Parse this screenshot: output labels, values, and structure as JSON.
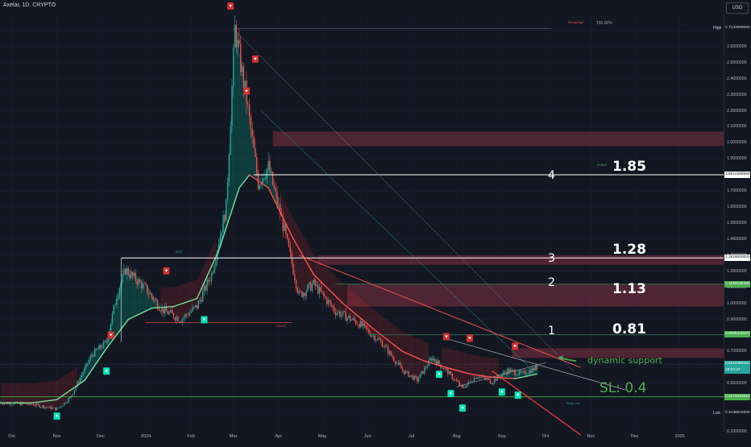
{
  "header": {
    "symbol": "Axelar",
    "interval": "1D",
    "exchange": "CRYPTO",
    "currency": "USD"
  },
  "colors": {
    "background": "#131722",
    "bull": "#26a69a",
    "bear": "#ef5350",
    "zone": "#b2394f",
    "band_teal": "#00e6b4",
    "band_red": "#d32f2f",
    "annotation_green": "#4caf50",
    "white": "#ffffff"
  },
  "chart_data": {
    "type": "candlestick",
    "title": "Axelar · 1D · CRYPTO",
    "y_axis": {
      "range": [
        0.2,
        2.8
      ],
      "ticks": [
        0.2,
        0.3,
        0.4,
        0.5,
        0.6,
        0.7,
        0.8,
        0.9,
        1.0,
        1.1,
        1.2,
        1.3,
        1.4,
        1.5,
        1.6,
        1.7,
        1.8,
        1.9,
        2.0,
        2.1,
        2.2,
        2.3,
        2.4,
        2.5,
        2.6,
        2.7
      ],
      "tick_labels": [
        "0.2000000",
        "0.3000000",
        "0.4000000",
        "0.5000000",
        "0.6000000",
        "0.7000000",
        "0.8000000",
        "0.9000000",
        "1.0000000",
        "1.1000000",
        "1.2000000",
        "1.3000000",
        "1.4000000",
        "1.5000000",
        "1.6000000",
        "1.7000000",
        "1.8000000",
        "1.9000000",
        "2.0000000",
        "2.1000000",
        "2.2000000",
        "2.3000000",
        "2.4000000",
        "2.5000000",
        "2.6000000",
        "2.7000000"
      ]
    },
    "x_axis": {
      "range": [
        "2023-09-23",
        "2025-01-31"
      ],
      "ticks": [
        {
          "date": "2023-10-01",
          "label": "Oct"
        },
        {
          "date": "2023-11-01",
          "label": "Nov"
        },
        {
          "date": "2023-12-01",
          "label": "Dec"
        },
        {
          "date": "2024-01-01",
          "label": "2024"
        },
        {
          "date": "2024-02-01",
          "label": "Feb"
        },
        {
          "date": "2024-03-01",
          "label": "Mar"
        },
        {
          "date": "2024-04-01",
          "label": "Apr"
        },
        {
          "date": "2024-05-01",
          "label": "May"
        },
        {
          "date": "2024-06-01",
          "label": "Jun"
        },
        {
          "date": "2024-07-01",
          "label": "Jul"
        },
        {
          "date": "2024-08-01",
          "label": "Aug"
        },
        {
          "date": "2024-09-01",
          "label": "Sep"
        },
        {
          "date": "2024-10-01",
          "label": "Oct"
        },
        {
          "date": "2024-11-01",
          "label": "Nov"
        },
        {
          "date": "2024-12-01",
          "label": "Dec"
        },
        {
          "date": "2025-01-01",
          "label": "2025"
        }
      ]
    },
    "price_path": [
      [
        "2023-09-23",
        0.38
      ],
      [
        "2023-10-15",
        0.37
      ],
      [
        "2023-11-01",
        0.34
      ],
      [
        "2023-11-10",
        0.41
      ],
      [
        "2023-11-25",
        0.68
      ],
      [
        "2023-12-05",
        0.76
      ],
      [
        "2023-12-12",
        1.05
      ],
      [
        "2023-12-18",
        1.21
      ],
      [
        "2024-01-01",
        1.09
      ],
      [
        "2024-01-12",
        0.96
      ],
      [
        "2024-01-25",
        0.9
      ],
      [
        "2024-02-05",
        0.98
      ],
      [
        "2024-02-15",
        1.18
      ],
      [
        "2024-02-25",
        1.6
      ],
      [
        "2024-03-02",
        2.71
      ],
      [
        "2024-03-10",
        2.27
      ],
      [
        "2024-03-18",
        1.75
      ],
      [
        "2024-03-25",
        1.85
      ],
      [
        "2024-04-05",
        1.45
      ],
      [
        "2024-04-15",
        1.05
      ],
      [
        "2024-04-25",
        1.12
      ],
      [
        "2024-05-10",
        0.95
      ],
      [
        "2024-05-25",
        0.88
      ],
      [
        "2024-06-10",
        0.76
      ],
      [
        "2024-06-25",
        0.58
      ],
      [
        "2024-07-05",
        0.52
      ],
      [
        "2024-07-15",
        0.66
      ],
      [
        "2024-07-25",
        0.58
      ],
      [
        "2024-08-05",
        0.47
      ],
      [
        "2024-08-15",
        0.55
      ],
      [
        "2024-08-25",
        0.51
      ],
      [
        "2024-09-05",
        0.58
      ],
      [
        "2024-09-15",
        0.56
      ],
      [
        "2024-09-25",
        0.6
      ]
    ],
    "ma_line": {
      "name": "",
      "points": [
        [
          "2023-09-23",
          0.38
        ],
        [
          "2023-10-15",
          0.38
        ],
        [
          "2023-11-01",
          0.4
        ],
        [
          "2023-11-20",
          0.52
        ],
        [
          "2023-12-05",
          0.72
        ],
        [
          "2023-12-20",
          0.9
        ],
        [
          "2024-01-05",
          0.97
        ],
        [
          "2024-01-20",
          0.98
        ],
        [
          "2024-02-05",
          1.03
        ],
        [
          "2024-02-20",
          1.33
        ],
        [
          "2024-03-05",
          1.72
        ],
        [
          "2024-03-12",
          1.8
        ],
        [
          "2024-03-25",
          1.72
        ],
        [
          "2024-04-10",
          1.42
        ],
        [
          "2024-04-25",
          1.18
        ],
        [
          "2024-05-15",
          1.0
        ],
        [
          "2024-06-05",
          0.84
        ],
        [
          "2024-06-25",
          0.7
        ],
        [
          "2024-07-10",
          0.64
        ],
        [
          "2024-07-25",
          0.6
        ],
        [
          "2024-08-10",
          0.56
        ],
        [
          "2024-08-25",
          0.54
        ],
        [
          "2024-09-10",
          0.53
        ],
        [
          "2024-09-25",
          0.56
        ]
      ]
    },
    "horizontal_levels": [
      {
        "id": "high",
        "value": 2.7133,
        "axis_label": "2.7133999090",
        "side_label": "High"
      },
      {
        "id": "l4",
        "value": 1.801,
        "axis_label": "1.8010369990",
        "number": "4",
        "target": "1.85"
      },
      {
        "id": "l3",
        "value": 1.2828,
        "axis_label": "1.2828000000",
        "number": "3",
        "target": "1.28"
      },
      {
        "id": "l2",
        "value": 1.1194,
        "axis_label": "1.1194239326",
        "number": "2",
        "target": "1.13"
      },
      {
        "id": "l1",
        "value": 0.8055,
        "axis_label": "0.8055440078",
        "number": "1",
        "target": "0.81"
      },
      {
        "id": "current",
        "value": 0.6211,
        "axis_label": "0.6211083110",
        "countdown": "19:20:37"
      },
      {
        "id": "sl",
        "value": 0.4175,
        "axis_label": "0.4174254819",
        "annotation": "SL: 0.4"
      },
      {
        "id": "low",
        "value": 0.3138,
        "axis_label": "0.3138616000",
        "side_label": "Low"
      }
    ],
    "supply_zones": [
      {
        "from": "2024-03-28",
        "to": "2025-01-31",
        "low": 1.98,
        "high": 2.07
      },
      {
        "from": "2024-04-28",
        "to": "2025-01-31",
        "low": 1.24,
        "high": 1.3
      },
      {
        "from": "2024-05-18",
        "to": "2025-01-31",
        "low": 0.98,
        "high": 1.12
      },
      {
        "from": "2024-09-08",
        "to": "2025-01-31",
        "low": 0.66,
        "high": 0.72
      }
    ],
    "annotations": {
      "fib_top": "100.00%",
      "fib_618": "61.80%",
      "strong_high": "Strong High",
      "weak_low": "Weak Low",
      "dynamic_support": "dynamic support",
      "bos": "BOS",
      "choch": "CHoCH"
    },
    "buy_signals": [
      [
        "2023-11-01",
        0.3
      ],
      [
        "2023-12-05",
        0.58
      ],
      [
        "2024-02-10",
        0.9
      ],
      [
        "2024-07-28",
        0.44
      ],
      [
        "2024-08-05",
        0.35
      ],
      [
        "2024-09-01",
        0.45
      ],
      [
        "2024-09-12",
        0.43
      ],
      [
        "2024-07-20",
        0.56
      ]
    ],
    "sell_signals": [
      [
        "2023-12-08",
        0.8
      ],
      [
        "2024-01-15",
        1.2
      ],
      [
        "2024-02-28",
        2.85
      ],
      [
        "2024-03-10",
        2.32
      ],
      [
        "2024-03-16",
        2.52
      ],
      [
        "2024-07-25",
        0.79
      ],
      [
        "2024-08-10",
        0.78
      ],
      [
        "2024-09-10",
        0.73
      ]
    ]
  }
}
